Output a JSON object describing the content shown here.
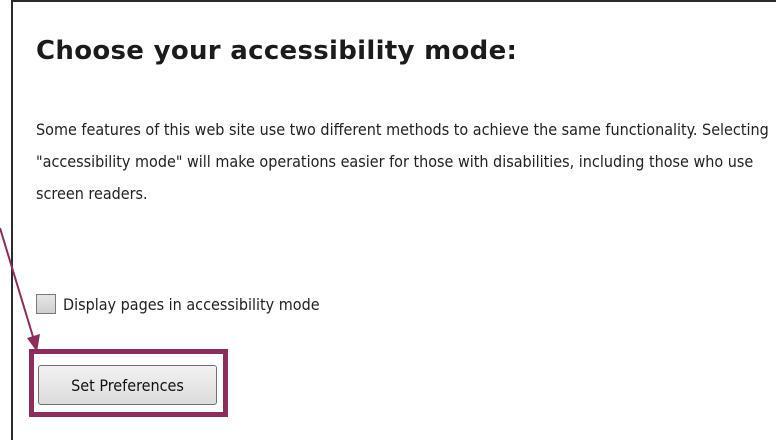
{
  "heading": "Choose your accessibility mode:",
  "description": "Some features of this web site use two different methods to achieve the same functionality. Selecting \"accessibility mode\" will make operations easier for those with disabilities, including those who use screen readers.",
  "checkbox": {
    "label": "Display pages in accessibility mode",
    "checked": false
  },
  "button": {
    "label": "Set Preferences"
  },
  "colors": {
    "highlight": "#8c2d5e",
    "arrow": "#8c2d5e",
    "panel_border": "#2b2b2b"
  }
}
